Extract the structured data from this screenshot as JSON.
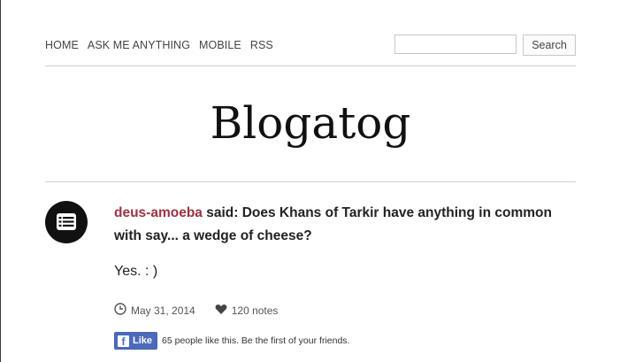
{
  "nav": {
    "items": [
      {
        "label": "HOME"
      },
      {
        "label": "ASK ME ANYTHING"
      },
      {
        "label": "MOBILE"
      },
      {
        "label": "RSS"
      }
    ]
  },
  "search": {
    "placeholder": "",
    "value": "",
    "button_label": "Search"
  },
  "blog": {
    "title": "Blogatog"
  },
  "post": {
    "type_icon": "chat-list-icon",
    "asker": "deus-amoeba",
    "question_text": " said: Does Khans of Tarkir have anything in common with say... a wedge of cheese?",
    "answer": "Yes. : )",
    "date": "May 31, 2014",
    "notes": "120 notes"
  },
  "facebook": {
    "like_label": "Like",
    "like_text": "65 people like this. Be the first of your friends.",
    "brand_color": "#4c69ba"
  },
  "colors": {
    "asker_link": "#9a3344",
    "text": "#222222",
    "divider": "#cfcfcf"
  }
}
